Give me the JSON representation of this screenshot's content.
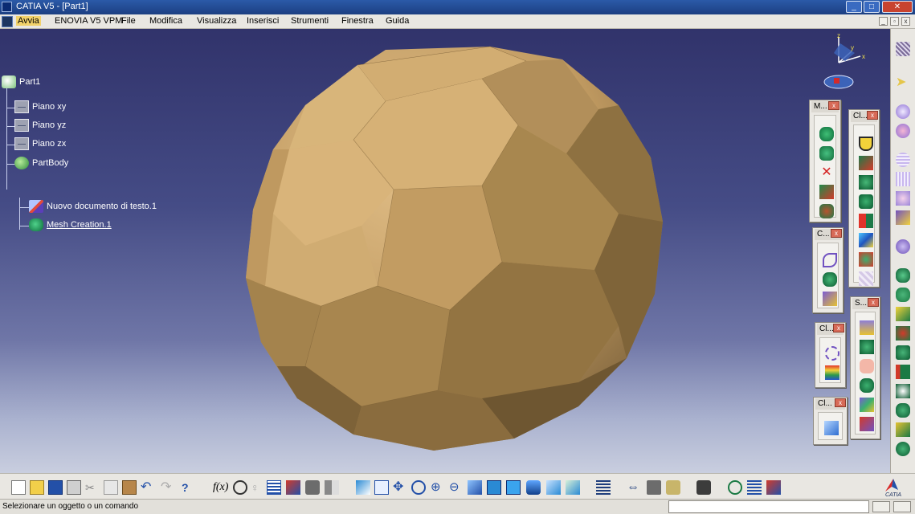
{
  "window": {
    "title": "CATIA V5 - [Part1]"
  },
  "menubar": {
    "items": [
      {
        "label": "Avvia",
        "active": true
      },
      {
        "label": "ENOVIA V5 VPM"
      },
      {
        "label": "File"
      },
      {
        "label": "Modifica"
      },
      {
        "label": "Visualizza"
      },
      {
        "label": "Inserisci"
      },
      {
        "label": "Strumenti"
      },
      {
        "label": "Finestra"
      },
      {
        "label": "Guida"
      }
    ]
  },
  "tree": {
    "root": "Part1",
    "planes": [
      "Piano xy",
      "Piano yz",
      "Piano zx"
    ],
    "body": "PartBody",
    "children": [
      "Nuovo documento di testo.1",
      "Mesh Creation.1"
    ]
  },
  "compass": {
    "x": "x",
    "y": "y",
    "z": "z"
  },
  "floating_toolbars": [
    {
      "title": "M..."
    },
    {
      "title": "Cl..."
    },
    {
      "title": "C..."
    },
    {
      "title": "S..."
    },
    {
      "title": "Cl..."
    },
    {
      "title": "Cl..."
    }
  ],
  "brand": {
    "logo_text": "CATIA"
  },
  "status": {
    "message": "Selezionare un oggetto o un comando"
  },
  "colors": {
    "solid_face": "#c8a46c",
    "viewport_top": "#31336b",
    "viewport_bottom": "#c9cedf"
  }
}
